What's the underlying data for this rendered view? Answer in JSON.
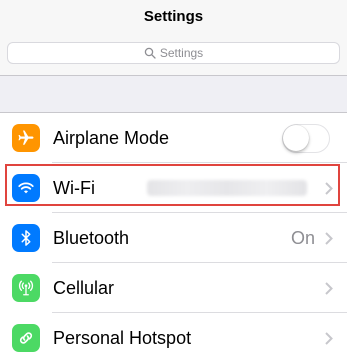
{
  "nav": {
    "title": "Settings"
  },
  "search": {
    "placeholder": "Settings"
  },
  "rows": [
    {
      "label": "Airplane Mode",
      "icon": "airplane-icon",
      "icon_color": "#ff9500",
      "toggle_on": false
    },
    {
      "label": "Wi-Fi",
      "icon": "wifi-icon",
      "icon_color": "#007aff",
      "value_blurred": true
    },
    {
      "label": "Bluetooth",
      "icon": "bluetooth-icon",
      "icon_color": "#007aff",
      "value": "On"
    },
    {
      "label": "Cellular",
      "icon": "cellular-icon",
      "icon_color": "#4cd964"
    },
    {
      "label": "Personal Hotspot",
      "icon": "hotspot-icon",
      "icon_color": "#4cd964"
    }
  ],
  "colors": {
    "background": "#efeff4",
    "highlight_border": "#e0443e"
  }
}
